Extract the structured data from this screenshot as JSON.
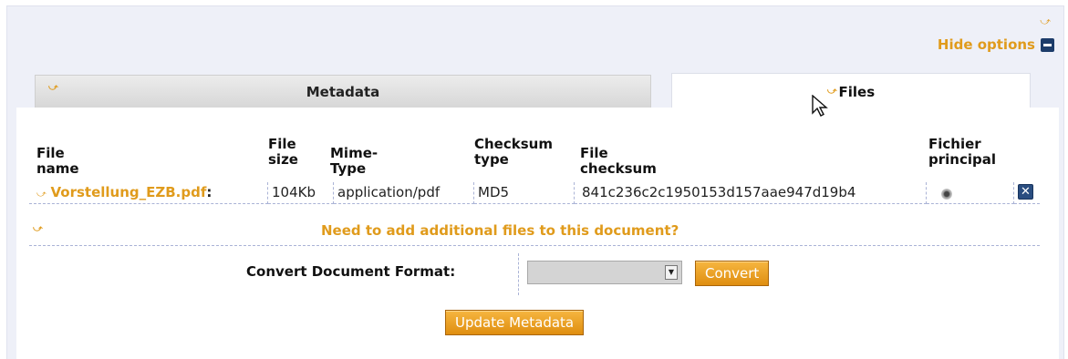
{
  "header": {
    "hide_options_label": "Hide options"
  },
  "tabs": [
    {
      "label": "Metadata",
      "active": false
    },
    {
      "label": "Files",
      "active": true
    }
  ],
  "files_table": {
    "columns": {
      "file_name": "File name",
      "file_size": [
        "File",
        "size"
      ],
      "mime_type": "Mime-Type",
      "checksum_type": [
        "Checksum",
        "type"
      ],
      "file_checksum": "File checksum",
      "principal": [
        "Fichier",
        "principal"
      ]
    },
    "rows": [
      {
        "file_name": "Vorstellung_EZB.pdf",
        "separator": ":",
        "file_size": "104Kb",
        "mime_type": "application/pdf",
        "checksum_type": "MD5",
        "file_checksum": "841c236c2c1950153d157aae947d19b4",
        "principal": true,
        "delete_glyph": "✕"
      }
    ]
  },
  "add_files_link": "Need to add additional files to this document?",
  "convert": {
    "label": "Convert Document Format:",
    "selected_value": "",
    "button_label": "Convert"
  },
  "update_button_label": "Update Metadata",
  "icons": {
    "hide": "minus-square-icon",
    "arrow": "orange-arrow-icon",
    "delete": "delete-x-icon"
  },
  "colors": {
    "accent": "#e09b1c",
    "panel_bg": "#eef0f8",
    "icon_navy": "#1c3c6a"
  }
}
